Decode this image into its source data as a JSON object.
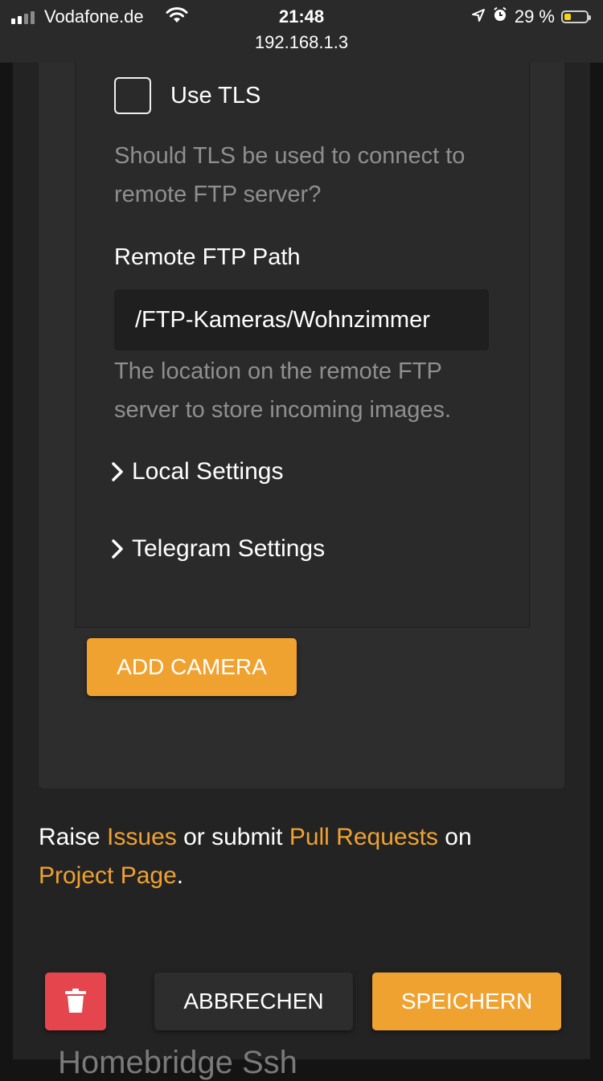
{
  "status_bar": {
    "carrier": "Vodafone.de",
    "time": "21:48",
    "battery_percent": "29 %",
    "battery_level": 0.29,
    "signal_bars": 2,
    "url": "192.168.1.3"
  },
  "form": {
    "use_tls": {
      "label": "Use TLS",
      "checked": false,
      "help": "Should TLS be used to connect to remote FTP server?"
    },
    "remote_ftp_path": {
      "label": "Remote FTP Path",
      "value": "/FTP-Kameras/Wohnzimmer",
      "help": "The location on the remote FTP server to store incoming images."
    },
    "sections": [
      {
        "label": "Local Settings",
        "expanded": false
      },
      {
        "label": "Telegram Settings",
        "expanded": false
      }
    ],
    "add_camera_label": "ADD CAMERA"
  },
  "footer": {
    "text_1": "Raise ",
    "link_issues": "Issues",
    "text_2": " or submit ",
    "link_pull_requests": "Pull Requests",
    "text_3": " on",
    "link_project_page": "Project Page",
    "text_4": "."
  },
  "actions": {
    "cancel_label": "ABBRECHEN",
    "save_label": "SPEICHERN"
  },
  "background_title": "Homebridge Ssh",
  "colors": {
    "accent": "#f0a230",
    "danger": "#e5454c",
    "background": "#232323",
    "card": "#2d2d2d"
  }
}
